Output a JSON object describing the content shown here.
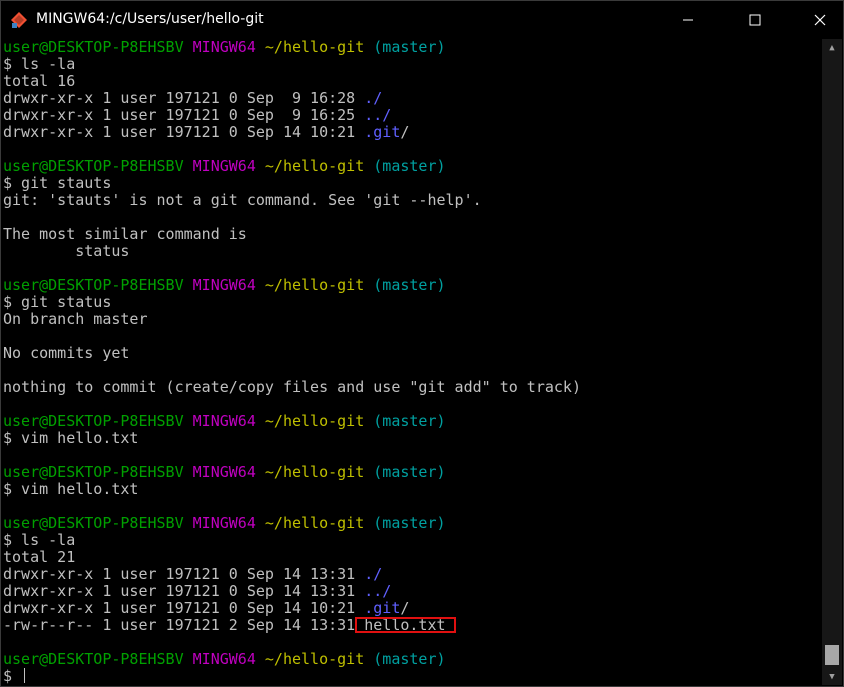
{
  "window": {
    "title": "MINGW64:/c/Users/user/hello-git"
  },
  "prompt": {
    "user": "user@DESKTOP-P8EHSBV",
    "env": "MINGW64",
    "path": "~/hello-git",
    "branch": "(master)"
  },
  "blocks": {
    "b1": {
      "cmd": "$ ls -la",
      "out": [
        "total 16",
        "drwxr-xr-x 1 user 197121 0 Sep  9 16:28 ",
        "drwxr-xr-x 1 user 197121 0 Sep  9 16:25 ",
        "drwxr-xr-x 1 user 197121 0 Sep 14 10:21 "
      ],
      "names": [
        "./",
        "../",
        ".git",
        "/"
      ]
    },
    "b2": {
      "cmd": "$ git stauts",
      "out": [
        "git: 'stauts' is not a git command. See 'git --help'.",
        "",
        "The most similar command is",
        "        status"
      ]
    },
    "b3": {
      "cmd": "$ git status",
      "out": [
        "On branch master",
        "",
        "No commits yet",
        "",
        "nothing to commit (create/copy files and use \"git add\" to track)"
      ]
    },
    "b4": {
      "cmd": "$ vim hello.txt"
    },
    "b5": {
      "cmd": "$ vim hello.txt"
    },
    "b6": {
      "cmd": "$ ls -la",
      "out": [
        "total 21",
        "drwxr-xr-x 1 user 197121 0 Sep 14 13:31 ",
        "drwxr-xr-x 1 user 197121 0 Sep 14 13:31 ",
        "drwxr-xr-x 1 user 197121 0 Sep 14 10:21 ",
        "-rw-r--r-- 1 user 197121 2 Sep 14 13:31 "
      ],
      "names": [
        "./",
        "../",
        ".git",
        "/",
        "hello.txt"
      ]
    },
    "b7": {
      "cmd": "$ "
    }
  },
  "colors": {
    "background": "#000000",
    "user": "#00a000",
    "mingw": "#c000c0",
    "path": "#bfbf00",
    "branch": "#00a0a0",
    "directory": "#6060ff",
    "text": "#c0c0c0",
    "highlight": "#e01010"
  },
  "icons": [
    "git-bash-icon",
    "minimize-icon",
    "maximize-icon",
    "close-icon",
    "scroll-up-arrow-icon",
    "scroll-down-arrow-icon"
  ]
}
